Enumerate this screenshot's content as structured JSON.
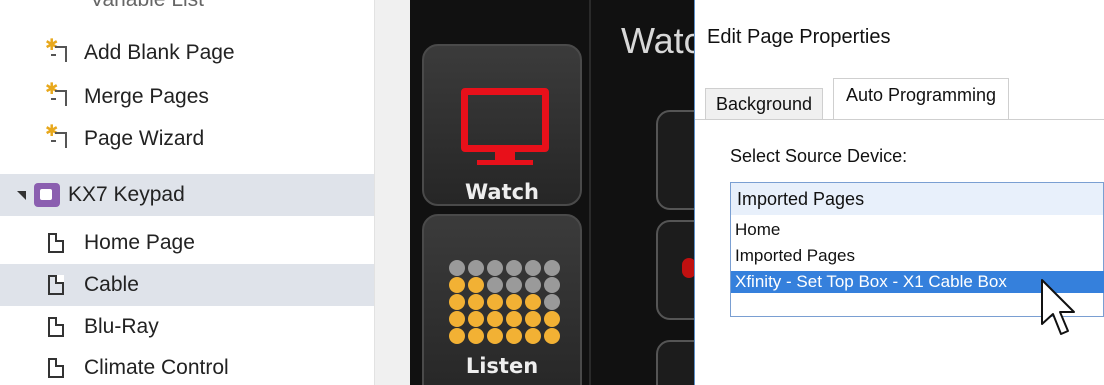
{
  "tree": {
    "cut_item": "Variable List",
    "actions": [
      {
        "label": "Add Blank Page",
        "icon": "new-page-star-icon"
      },
      {
        "label": "Merge Pages",
        "icon": "new-page-star-icon"
      },
      {
        "label": "Page Wizard",
        "icon": "new-page-star-icon"
      }
    ],
    "device": {
      "label": "KX7 Keypad",
      "icon": "keypad-device-icon",
      "expanded": true
    },
    "pages": [
      {
        "label": "Home Page",
        "selected": false
      },
      {
        "label": "Cable",
        "selected": true
      },
      {
        "label": "Blu-Ray",
        "selected": false
      },
      {
        "label": "Climate Control",
        "selected": false
      }
    ]
  },
  "keypad": {
    "title": "Watch",
    "buttons": [
      {
        "label": "Watch",
        "icon": "tv-icon"
      },
      {
        "label": "Listen",
        "icon": "speaker-grid-icon"
      }
    ],
    "colors": {
      "tv": "#e8101a",
      "dot_gray": "#9a9a9a",
      "dot_amber": "#f2b134",
      "background": "#111111"
    }
  },
  "dialog": {
    "title": "Edit Page Properties",
    "tabs": [
      {
        "label": "Background",
        "active": false
      },
      {
        "label": "Auto Programming",
        "active": true
      }
    ],
    "source_label": "Select Source Device:",
    "source_selected": "Imported Pages",
    "source_options": [
      {
        "label": "Home",
        "highlighted": false
      },
      {
        "label": "Imported Pages",
        "highlighted": false
      },
      {
        "label": "Xfinity - Set Top Box - X1 Cable Box",
        "highlighted": true
      }
    ],
    "colors": {
      "highlight": "#3580dc",
      "select_border": "#7a9fd2"
    }
  }
}
